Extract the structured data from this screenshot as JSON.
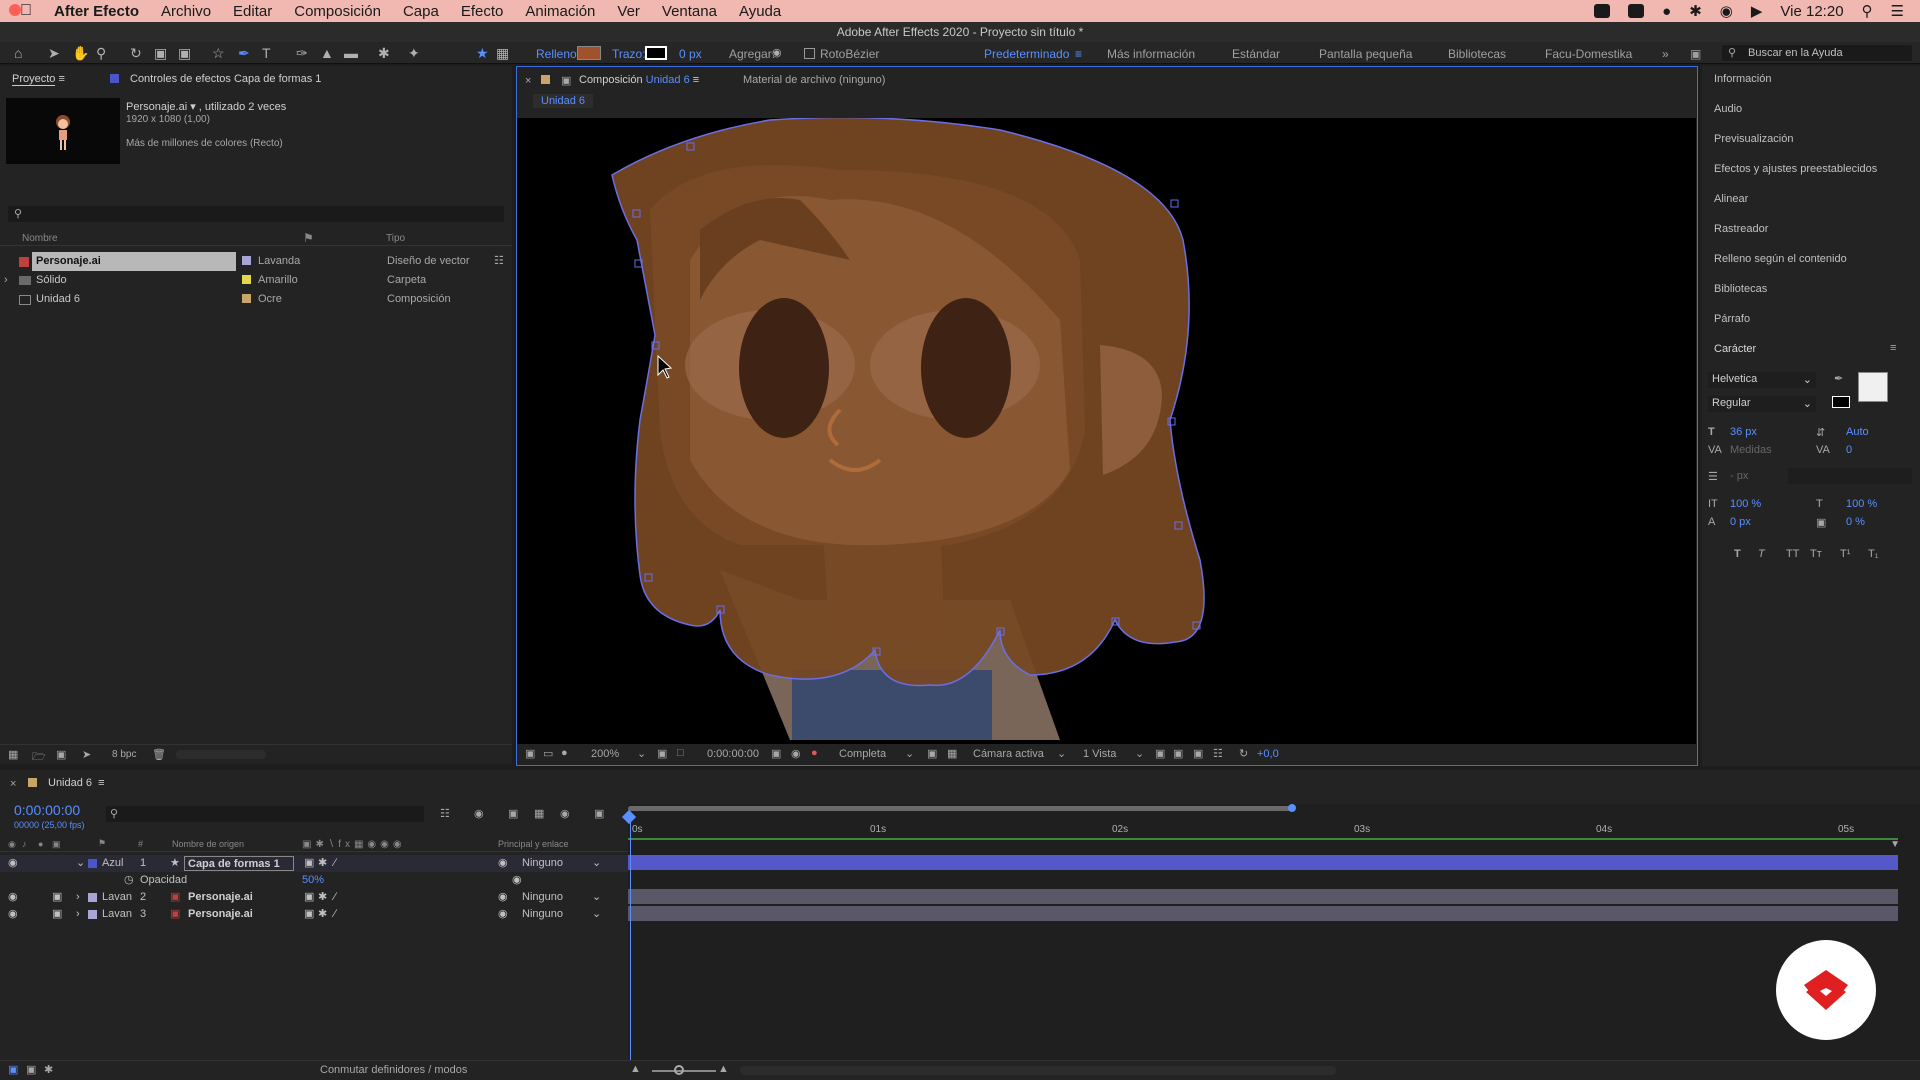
{
  "menubar": {
    "app_name": "After Efecto",
    "menus": [
      "Archivo",
      "Editar",
      "Composición",
      "Capa",
      "Efecto",
      "Animación",
      "Ver",
      "Ventana",
      "Ayuda"
    ],
    "clock": "Vie 12:20"
  },
  "window": {
    "title": "Adobe After Effects 2020 - Proyecto sin título *"
  },
  "toolbar": {
    "fill_label": "Relleno:",
    "stroke_label": "Trazo:",
    "stroke_width": "0 px",
    "add_label": "Agregar:",
    "roto_bezier": "RotoBézier",
    "workspaces": [
      "Predeterminado",
      "Más información",
      "Estándar",
      "Pantalla pequeña",
      "Bibliotecas",
      "Facu-Domestika"
    ],
    "search_placeholder": "Buscar en la Ayuda",
    "fill_color": "#a0522d"
  },
  "project": {
    "tab": "Proyecto",
    "effects_tab": "Controles de efectos Capa de formas 1",
    "item_name": "Personaje.ai ▾ , utilizado 2 veces",
    "item_dims": "1920 x 1080 (1,00)",
    "item_colors": "Más de millones de colores (Recto)",
    "col_name": "Nombre",
    "col_type": "Tipo",
    "bpc": "8 bpc",
    "rows": [
      {
        "name": "Personaje.ai",
        "label": "Lavanda",
        "label_color": "#a9a4d6",
        "type": "Diseño de vector"
      },
      {
        "name": "Sólido",
        "label": "Amarillo",
        "label_color": "#e4d84a",
        "type": "Carpeta"
      },
      {
        "name": "Unidad 6",
        "label": "Ocre",
        "label_color": "#c8a66a",
        "type": "Composición"
      }
    ]
  },
  "comp": {
    "tab_prefix": "Composición",
    "tab_name": "Unidad 6",
    "footage_tab": "Material de archivo (ninguno)",
    "breadcrumb": "Unidad 6",
    "zoom": "200%",
    "time": "0:00:00:00",
    "resolution": "Completa",
    "camera": "Cámara activa",
    "views": "1 Vista",
    "exposure": "+0,0"
  },
  "right_panel": {
    "items": [
      "Información",
      "Audio",
      "Previsualización",
      "Efectos y ajustes preestablecidos",
      "Alinear",
      "Rastreador",
      "Relleno según el contenido",
      "Bibliotecas",
      "Párrafo",
      "Carácter"
    ],
    "font": "Helvetica",
    "style": "Regular",
    "size": "36 px",
    "leading": "Auto",
    "tracking_mode": "Medidas",
    "tracking": "0",
    "stroke_px": "- px",
    "vscale": "100 %",
    "hscale": "100 %",
    "baseline": "0 px",
    "tsume": "0 %"
  },
  "timeline": {
    "tab": "Unidad 6",
    "timecode": "0:00:00:00",
    "fps": "00000 (25,00 fps)",
    "col_source": "Nombre de origen",
    "col_parent": "Principal y enlace",
    "toggle_label": "Conmutar definidores / modos",
    "ticks": [
      "0s",
      "01s",
      "02s",
      "03s",
      "04s",
      "05s"
    ],
    "layers": [
      {
        "label": "Azul",
        "num": "1",
        "name": "Capa de formas 1",
        "parent": "Ninguno",
        "color": "#4a55c8"
      },
      {
        "label": "Lavan",
        "num": "2",
        "name": "Personaje.ai",
        "parent": "Ninguno",
        "color": "#a9a4d6"
      },
      {
        "label": "Lavan",
        "num": "3",
        "name": "Personaje.ai",
        "parent": "Ninguno",
        "color": "#a9a4d6"
      }
    ],
    "opacity_label": "Opacidad",
    "opacity_value": "50%"
  }
}
